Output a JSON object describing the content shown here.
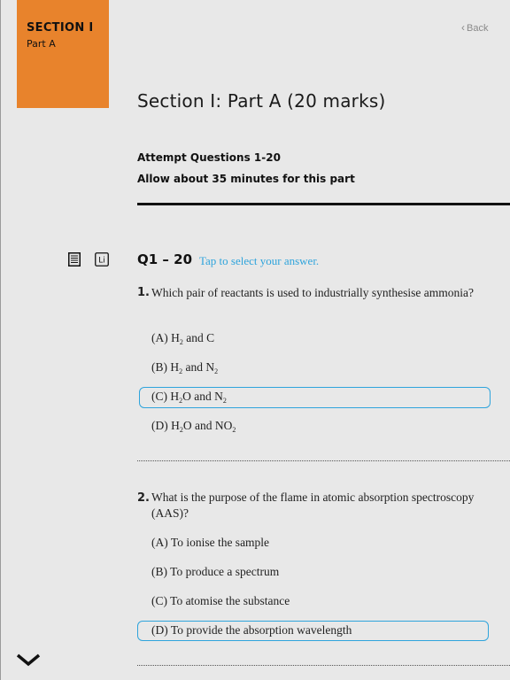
{
  "colors": {
    "accent": "#e8832c",
    "selection": "#2fa4dc",
    "background": "#e8e8e8"
  },
  "section_tab": {
    "title": "SECTION I",
    "subtitle": "Part A"
  },
  "nav": {
    "back_label": "Back",
    "back_icon": "chevron-left-icon"
  },
  "page": {
    "title": "Section I: Part A (20 marks)",
    "instructions": [
      "Attempt Questions 1-20",
      "Allow about 35 minutes for this part"
    ]
  },
  "tools": [
    {
      "icon": "periodic-table-icon"
    },
    {
      "icon": "element-symbol-icon",
      "label": "Li"
    }
  ],
  "questions_header": {
    "range": "Q1 – 20",
    "hint": "Tap to select your answer."
  },
  "questions": [
    {
      "number": "1.",
      "text": "Which pair of reactants is used to industrially synthesise ammonia?",
      "selected": "C",
      "options": [
        {
          "letter": "(A)",
          "parts": [
            "H",
            "2",
            " and C"
          ]
        },
        {
          "letter": "(B)",
          "parts": [
            "H",
            "2",
            " and N",
            "2"
          ]
        },
        {
          "letter": "(C)",
          "parts": [
            "H",
            "2",
            "O and N",
            "2"
          ]
        },
        {
          "letter": "(D)",
          "parts": [
            "H",
            "2",
            "O and NO",
            "2"
          ]
        }
      ]
    },
    {
      "number": "2.",
      "text": "What is the purpose of the flame in atomic absorption spectroscopy (AAS)?",
      "selected": "D",
      "options": [
        {
          "letter": "(A)",
          "text": "To ionise the sample"
        },
        {
          "letter": "(B)",
          "text": "To produce a spectrum"
        },
        {
          "letter": "(C)",
          "text": "To atomise the substance"
        },
        {
          "letter": "(D)",
          "text": "To provide the absorption wavelength"
        }
      ]
    }
  ],
  "scroll_icon": "chevron-down-icon"
}
